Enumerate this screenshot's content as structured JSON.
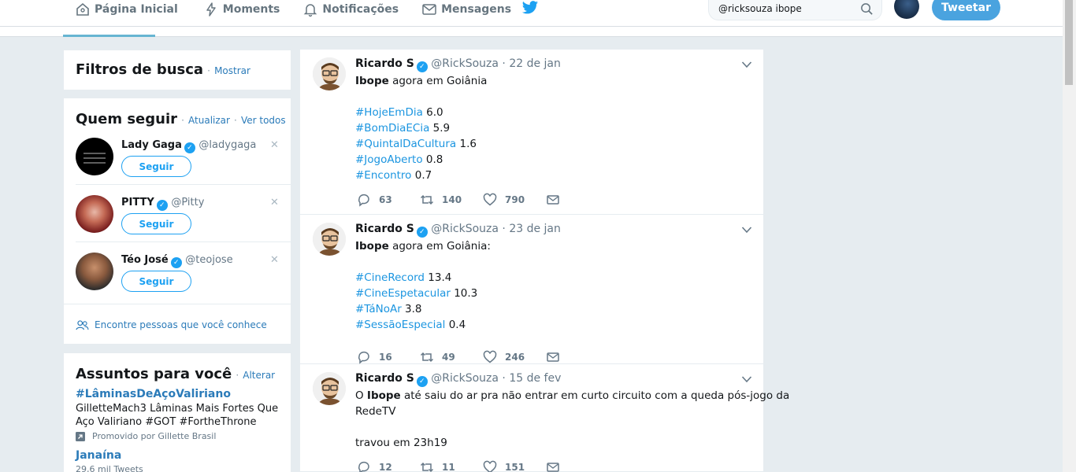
{
  "nav": {
    "items": [
      {
        "label": "Página Inicial"
      },
      {
        "label": "Moments"
      },
      {
        "label": "Notificações"
      },
      {
        "label": "Mensagens"
      }
    ],
    "search_value": "@ricksouza ibope",
    "tweet_button": "Tweetar"
  },
  "filters": {
    "title": "Filtros de busca",
    "link": "Mostrar"
  },
  "who_to_follow": {
    "title": "Quem seguir",
    "refresh": "Atualizar",
    "view_all": "Ver todos",
    "follow_label": "Seguir",
    "users": [
      {
        "name": "Lady Gaga",
        "handle": "@ladygaga"
      },
      {
        "name": "PITTY",
        "handle": "@Pitty"
      },
      {
        "name": "Téo José",
        "handle": "@teojose"
      }
    ],
    "find_people": "Encontre pessoas que você conhece"
  },
  "trends": {
    "title": "Assuntos para você",
    "change": "Alterar",
    "items": [
      {
        "name": "#LâminasDeAçoValiriano",
        "desc_line1": "GilletteMach3 Lâminas Mais Fortes Que",
        "desc_line2": "Aço Valiriano #GOT #FortheThrone",
        "promoted": "Promovido por Gillette Brasil"
      },
      {
        "name": "Janaína",
        "count": "29,6 mil Tweets"
      }
    ]
  },
  "tweets": [
    {
      "name": "Ricardo S",
      "handle": "@RickSouza",
      "date": "22 de jan",
      "lines": [
        [
          {
            "t": "Ibope",
            "b": true
          },
          {
            "t": " agora em Goiânia"
          }
        ],
        [],
        [
          {
            "t": "#HojeEmDia",
            "h": true
          },
          {
            "t": " 6.0"
          }
        ],
        [
          {
            "t": "#BomDiaECia",
            "h": true
          },
          {
            "t": " 5.9"
          }
        ],
        [
          {
            "t": "#QuintalDaCultura",
            "h": true
          },
          {
            "t": " 1.6"
          }
        ],
        [
          {
            "t": "#JogoAberto",
            "h": true
          },
          {
            "t": " 0.8"
          }
        ],
        [
          {
            "t": "#Encontro",
            "h": true
          },
          {
            "t": " 0.7"
          }
        ]
      ],
      "replies": "63",
      "retweets": "140",
      "likes": "790"
    },
    {
      "name": "Ricardo S",
      "handle": "@RickSouza",
      "date": "23 de jan",
      "lines": [
        [
          {
            "t": "Ibope",
            "b": true
          },
          {
            "t": " agora em Goiânia:"
          }
        ],
        [],
        [
          {
            "t": "#CineRecord",
            "h": true
          },
          {
            "t": " 13.4"
          }
        ],
        [
          {
            "t": "#CineEspetacular",
            "h": true
          },
          {
            "t": " 10.3"
          }
        ],
        [
          {
            "t": "#TáNoAr",
            "h": true
          },
          {
            "t": " 3.8"
          }
        ],
        [
          {
            "t": "#SessãoEspecial",
            "h": true
          },
          {
            "t": " 0.4"
          }
        ]
      ],
      "replies": "16",
      "retweets": "49",
      "likes": "246"
    },
    {
      "name": "Ricardo S",
      "handle": "@RickSouza",
      "date": "15 de fev",
      "lines": [
        [
          {
            "t": "O "
          },
          {
            "t": "Ibope",
            "b": true
          },
          {
            "t": " até saiu do ar pra não entrar em curto circuito com a queda pós-jogo da"
          }
        ],
        [
          {
            "t": "RedeTV"
          }
        ],
        [],
        [
          {
            "t": "travou em 23h19"
          }
        ]
      ],
      "replies": "12",
      "retweets": "11",
      "likes": "151"
    }
  ],
  "colors": {
    "accent": "#1da1f2",
    "background": "#e6ecf0",
    "link": "#1b95e0"
  }
}
